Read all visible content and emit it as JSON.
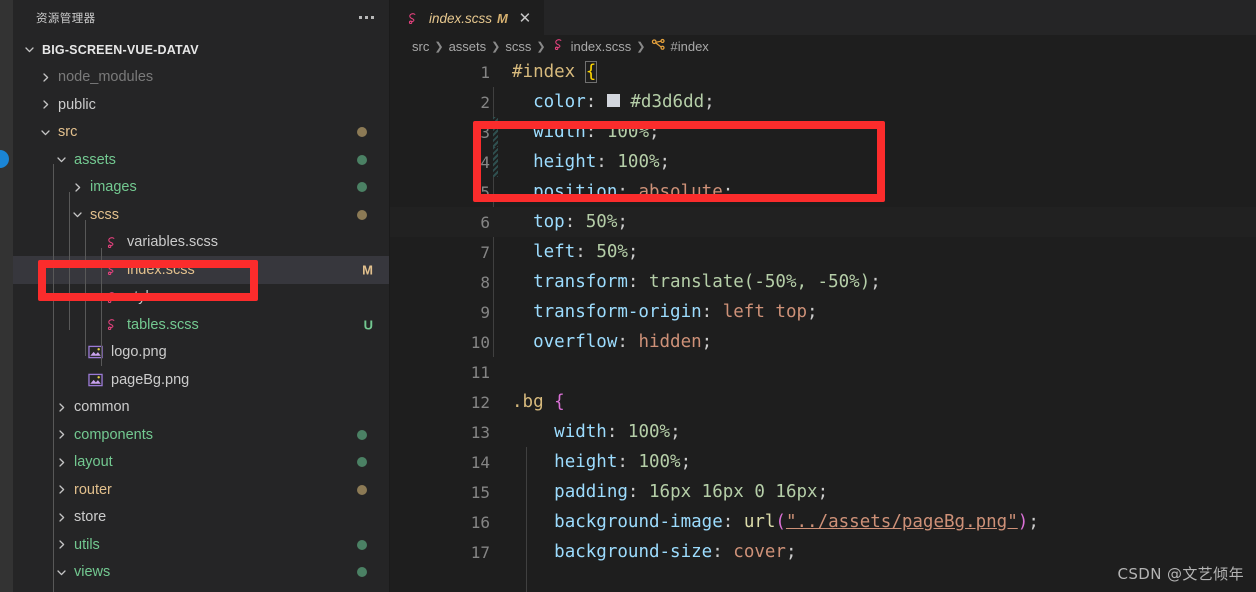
{
  "window": {
    "accent_red": "#fb2c2c",
    "editor_bg": "#1e1e1e",
    "sidebar_bg": "#252526"
  },
  "sidebar": {
    "title": "资源管理器",
    "more_label": "...",
    "root": {
      "label": "BIG-SCREEN-VUE-DATAV",
      "twisty": "chevron-down-icon"
    },
    "items": [
      {
        "label": "node_modules",
        "type": "folder",
        "indent": 1,
        "twisty": "chevron-right-icon",
        "color": "muted",
        "badge": "",
        "dot": ""
      },
      {
        "label": "public",
        "type": "folder",
        "indent": 1,
        "twisty": "chevron-right-icon",
        "color": "plain",
        "badge": "",
        "dot": ""
      },
      {
        "label": "src",
        "type": "folder",
        "indent": 1,
        "twisty": "chevron-down-icon",
        "color": "mod",
        "badge": "",
        "dot": "mod"
      },
      {
        "label": "assets",
        "type": "folder",
        "indent": 2,
        "twisty": "chevron-down-icon",
        "color": "untrk",
        "badge": "",
        "dot": "untrk"
      },
      {
        "label": "images",
        "type": "folder",
        "indent": 3,
        "twisty": "chevron-right-icon",
        "color": "untrk",
        "badge": "",
        "dot": "untrk"
      },
      {
        "label": "scss",
        "type": "folder",
        "indent": 3,
        "twisty": "chevron-down-icon",
        "color": "mod",
        "badge": "",
        "dot": "mod"
      },
      {
        "label": "variables.scss",
        "type": "scss",
        "indent": 4,
        "twisty": "",
        "color": "plain",
        "badge": "",
        "dot": ""
      },
      {
        "label": "index.scss",
        "type": "scss",
        "indent": 4,
        "twisty": "",
        "color": "mod",
        "badge": "M",
        "badge_kind": "mod",
        "dot": "",
        "selected": true
      },
      {
        "label": "style.scss",
        "type": "scss",
        "indent": 4,
        "twisty": "",
        "color": "plain",
        "badge": "",
        "dot": ""
      },
      {
        "label": "tables.scss",
        "type": "scss",
        "indent": 4,
        "twisty": "",
        "color": "untrk",
        "badge": "U",
        "badge_kind": "untrk",
        "dot": ""
      },
      {
        "label": "logo.png",
        "type": "image",
        "indent": 3,
        "twisty": "",
        "color": "plain",
        "badge": "",
        "dot": ""
      },
      {
        "label": "pageBg.png",
        "type": "image",
        "indent": 3,
        "twisty": "",
        "color": "plain",
        "badge": "",
        "dot": ""
      },
      {
        "label": "common",
        "type": "folder",
        "indent": 2,
        "twisty": "chevron-right-icon",
        "color": "plain",
        "badge": "",
        "dot": ""
      },
      {
        "label": "components",
        "type": "folder",
        "indent": 2,
        "twisty": "chevron-right-icon",
        "color": "untrk",
        "badge": "",
        "dot": "untrk"
      },
      {
        "label": "layout",
        "type": "folder",
        "indent": 2,
        "twisty": "chevron-right-icon",
        "color": "untrk",
        "badge": "",
        "dot": "untrk"
      },
      {
        "label": "router",
        "type": "folder",
        "indent": 2,
        "twisty": "chevron-right-icon",
        "color": "mod",
        "badge": "",
        "dot": "mod"
      },
      {
        "label": "store",
        "type": "folder",
        "indent": 2,
        "twisty": "chevron-right-icon",
        "color": "plain",
        "badge": "",
        "dot": ""
      },
      {
        "label": "utils",
        "type": "folder",
        "indent": 2,
        "twisty": "chevron-right-icon",
        "color": "untrk",
        "badge": "",
        "dot": "untrk"
      },
      {
        "label": "views",
        "type": "folder",
        "indent": 2,
        "twisty": "chevron-down-icon",
        "color": "untrk",
        "badge": "",
        "dot": "untrk"
      }
    ]
  },
  "editor": {
    "tab": {
      "icon": "scss-file-icon",
      "title": "index.scss",
      "dirty_badge": "M",
      "close_label": "✕"
    },
    "breadcrumb": [
      {
        "label": "src",
        "icon": ""
      },
      {
        "label": "assets",
        "icon": ""
      },
      {
        "label": "scss",
        "icon": ""
      },
      {
        "label": "index.scss",
        "icon": "scss-file-icon"
      },
      {
        "label": "#index",
        "icon": "css-selector-icon"
      }
    ],
    "lines": [
      {
        "n": "1",
        "active": false,
        "diff": ""
      },
      {
        "n": "2",
        "active": false,
        "diff": ""
      },
      {
        "n": "3",
        "active": false,
        "diff": "added"
      },
      {
        "n": "4",
        "active": false,
        "diff": "added"
      },
      {
        "n": "5",
        "active": false,
        "diff": ""
      },
      {
        "n": "6",
        "active": true,
        "diff": ""
      },
      {
        "n": "7",
        "active": false,
        "diff": ""
      },
      {
        "n": "8",
        "active": false,
        "diff": ""
      },
      {
        "n": "9",
        "active": false,
        "diff": ""
      },
      {
        "n": "10",
        "active": false,
        "diff": ""
      },
      {
        "n": "11",
        "active": false,
        "diff": ""
      },
      {
        "n": "12",
        "active": false,
        "diff": ""
      },
      {
        "n": "13",
        "active": false,
        "diff": ""
      },
      {
        "n": "14",
        "active": false,
        "diff": ""
      },
      {
        "n": "15",
        "active": false,
        "diff": ""
      },
      {
        "n": "16",
        "active": false,
        "diff": ""
      },
      {
        "n": "17",
        "active": false,
        "diff": ""
      }
    ],
    "source_text": [
      "#index {",
      "  color: #d3d6dd;",
      "  width: 100%;",
      "  height: 100%;",
      "  position: absolute;",
      "  top: 50%;",
      "  left: 50%;",
      "  transform: translate(-50%, -50%);",
      "  transform-origin: left top;",
      "  overflow: hidden;",
      "",
      "  .bg {",
      "    width: 100%;",
      "    height: 100%;",
      "    padding: 16px 16px 0 16px;",
      "    background-image: url(\"../assets/pageBg.png\");",
      "    background-size: cover;"
    ],
    "color_swatch_value": "#d3d6dd"
  },
  "annotations": [
    {
      "name": "code-highlight-box",
      "target": "width/height lines"
    },
    {
      "name": "file-highlight-box",
      "target": "index.scss tree row"
    }
  ],
  "watermark": {
    "text": "CSDN @文艺倾年"
  }
}
